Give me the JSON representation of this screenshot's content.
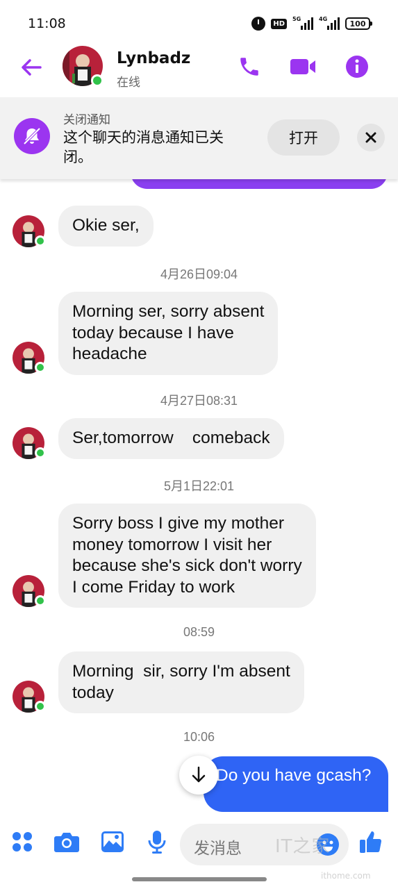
{
  "status_bar": {
    "time": "11:08",
    "net1": "5G",
    "net2": "4G",
    "battery": "100"
  },
  "header": {
    "contact_name": "Lynbadz",
    "contact_status": "在线",
    "accent_color": "#9b35f0"
  },
  "banner": {
    "title": "关闭通知",
    "text": "这个聊天的消息通知已关闭。",
    "open_label": "打开"
  },
  "messages": [
    {
      "text": "Okie ser,"
    },
    {
      "timestamp": "4月26日09:04"
    },
    {
      "text": "Morning ser, sorry absent\ntoday because I have\nheadache"
    },
    {
      "timestamp": "4月27日08:31"
    },
    {
      "text": "Ser,tomorrow    comeback"
    },
    {
      "timestamp": "5月1日22:01"
    },
    {
      "text": "Sorry boss I give my mother\nmoney tomorrow I visit her\nbecause she's sick don't worry\nI come Friday to work"
    },
    {
      "timestamp": "08:59"
    },
    {
      "text": "Morning  sir, sorry I'm absent\ntoday"
    },
    {
      "timestamp": "10:06"
    },
    {
      "text": "Do you have gcash?",
      "outgoing": true
    }
  ],
  "composer": {
    "placeholder": "发消息"
  },
  "watermark": {
    "text": "IT之家",
    "sub": "ithome.com"
  },
  "colors": {
    "outgoing_bubble": "#2f64f5",
    "incoming_bubble": "#f0f0f0",
    "online": "#31c24a",
    "composer_icons": "#2e7cf6"
  },
  "icons": [
    "back-arrow-icon",
    "phone-icon",
    "video-camera-icon",
    "info-icon",
    "bell-off-icon",
    "close-icon",
    "arrow-down-icon",
    "apps-grid-icon",
    "camera-icon",
    "image-icon",
    "microphone-icon",
    "emoji-icon",
    "thumbs-up-icon"
  ]
}
